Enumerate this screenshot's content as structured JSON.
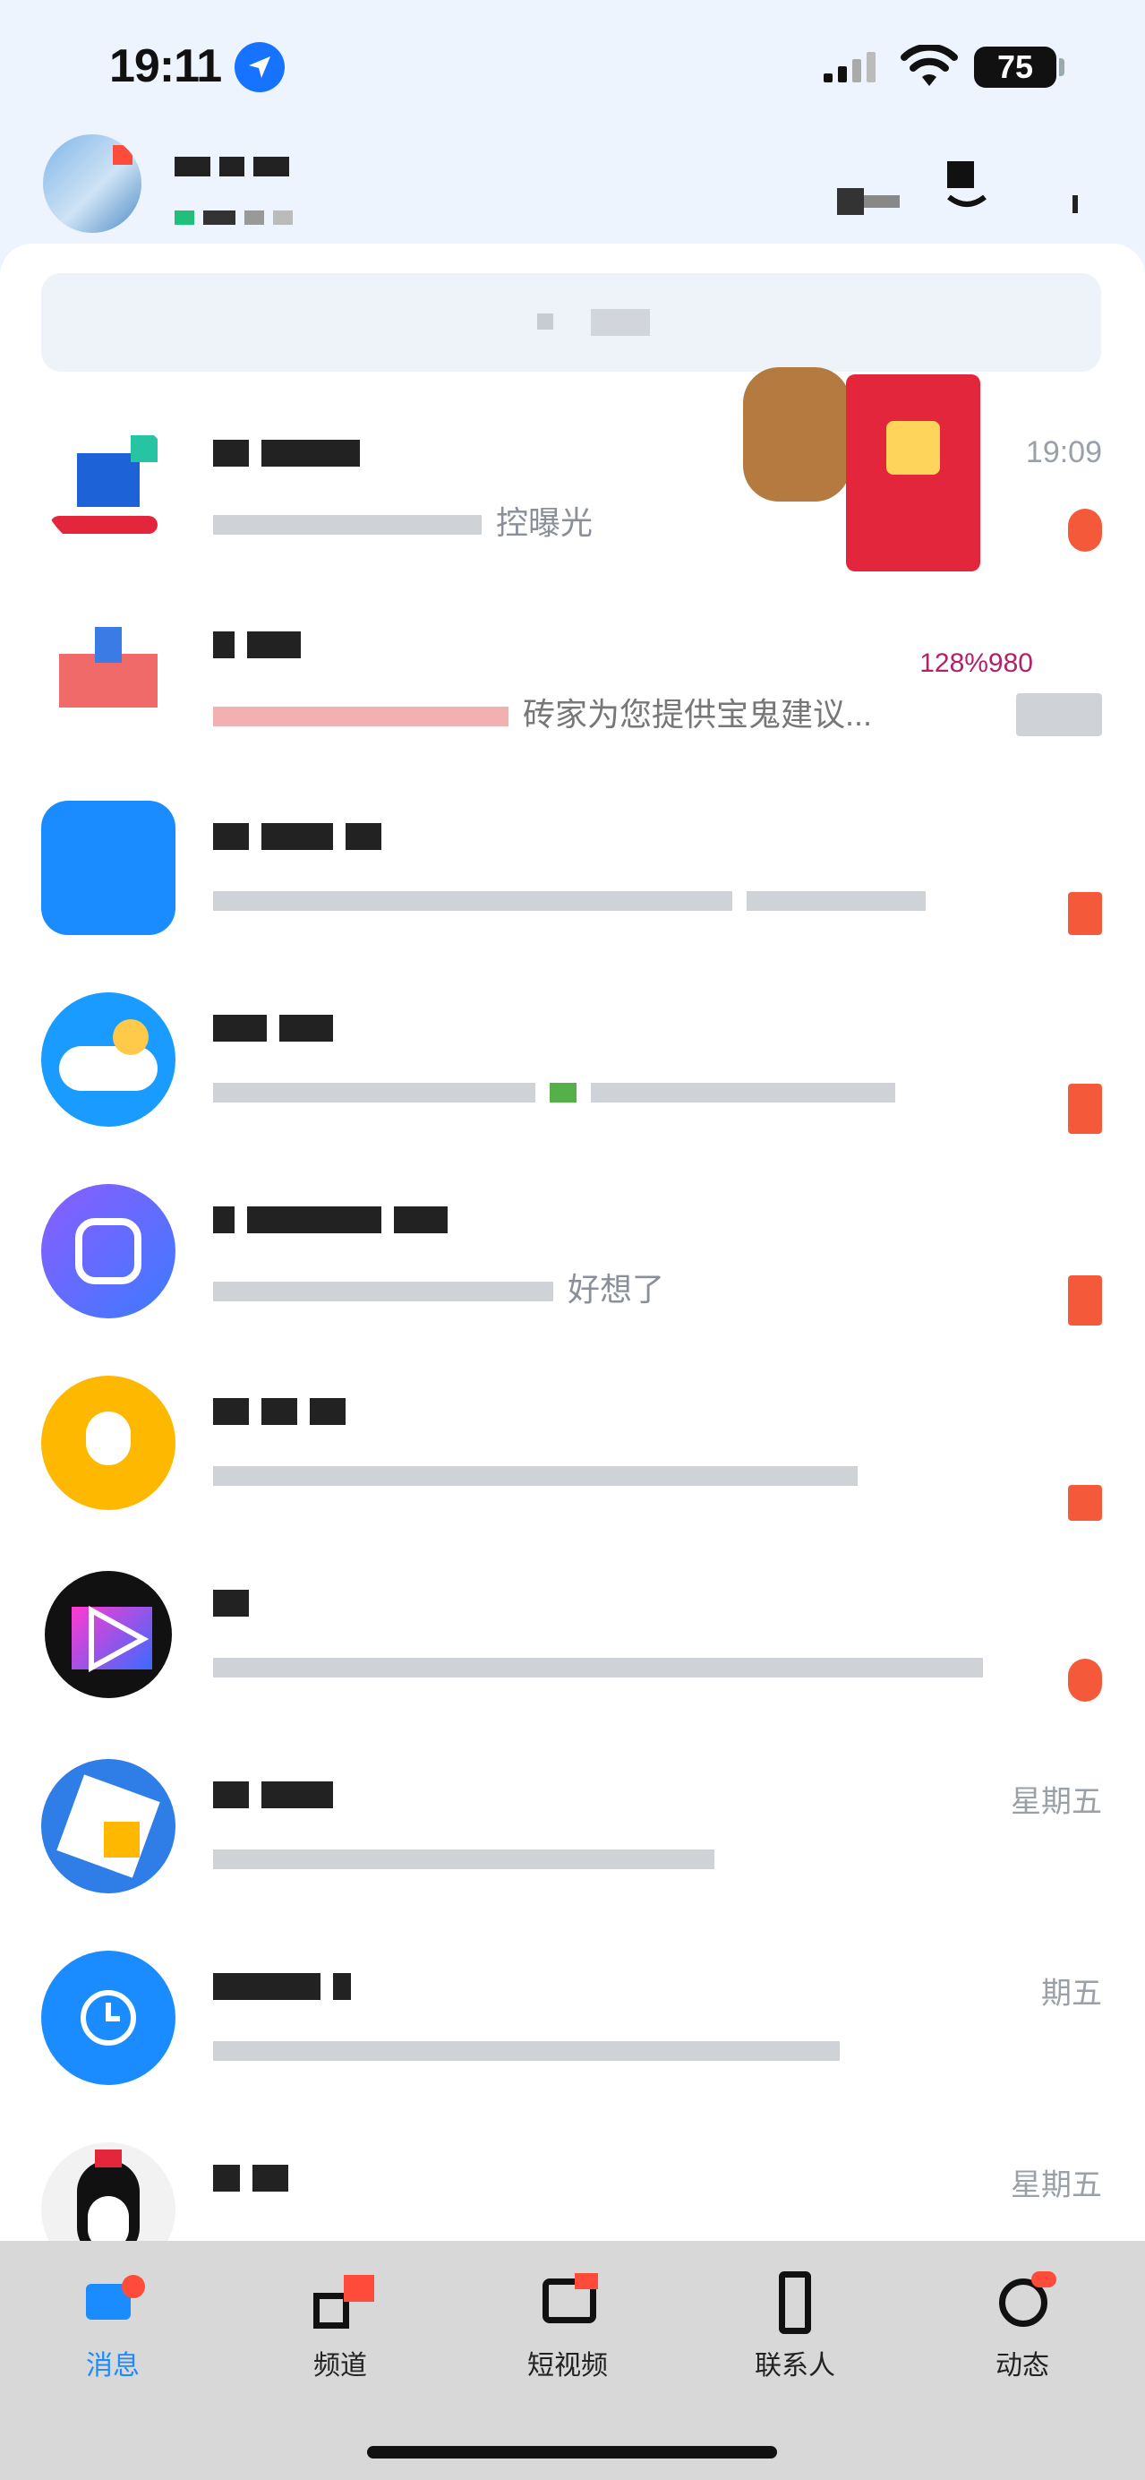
{
  "status_bar": {
    "time": "19:11",
    "battery": "75",
    "location_icon": "location-arrow-icon",
    "signal_icon": "cellular-signal-icon",
    "wifi_icon": "wifi-icon"
  },
  "search": {
    "icon": "search-icon"
  },
  "chats": [
    {
      "timestamp": "19:09",
      "preview_visible": "控曝光",
      "avatar_color": "#1e62d8"
    },
    {
      "timestamp": "",
      "preview_visible": "砖家为您提供宝鬼建议...",
      "badge_text": "128%980",
      "avatar_color": "#e84a4a"
    },
    {
      "timestamp": "",
      "preview_visible": "",
      "avatar_color": "#1a8cff"
    },
    {
      "timestamp": "",
      "preview_visible": "",
      "avatar_color": "#1a9bff"
    },
    {
      "timestamp": "",
      "preview_visible": "好想了",
      "avatar_color": "#6d5cff"
    },
    {
      "timestamp": "",
      "preview_visible": "",
      "avatar_color": "#ffb800"
    },
    {
      "timestamp": "",
      "preview_visible": "",
      "avatar_color": "#111111"
    },
    {
      "timestamp": "星期五",
      "preview_visible": "",
      "avatar_color": "#2f7ee8"
    },
    {
      "timestamp": "期五",
      "preview_visible": "",
      "avatar_color": "#1a8cff"
    },
    {
      "timestamp": "星期五",
      "preview_visible": "",
      "avatar_color": "#f2f2f2"
    }
  ],
  "tabs": [
    {
      "label": "消息",
      "icon": "messages-icon",
      "active": true
    },
    {
      "label": "频道",
      "icon": "channels-icon",
      "active": false
    },
    {
      "label": "短视频",
      "icon": "short-video-icon",
      "active": false
    },
    {
      "label": "联系人",
      "icon": "contacts-icon",
      "active": false
    },
    {
      "label": "动态",
      "icon": "moments-icon",
      "active": false
    }
  ],
  "colors": {
    "accent": "#1a8cff",
    "badge": "#f45a3a",
    "background": "#eef4fd"
  }
}
